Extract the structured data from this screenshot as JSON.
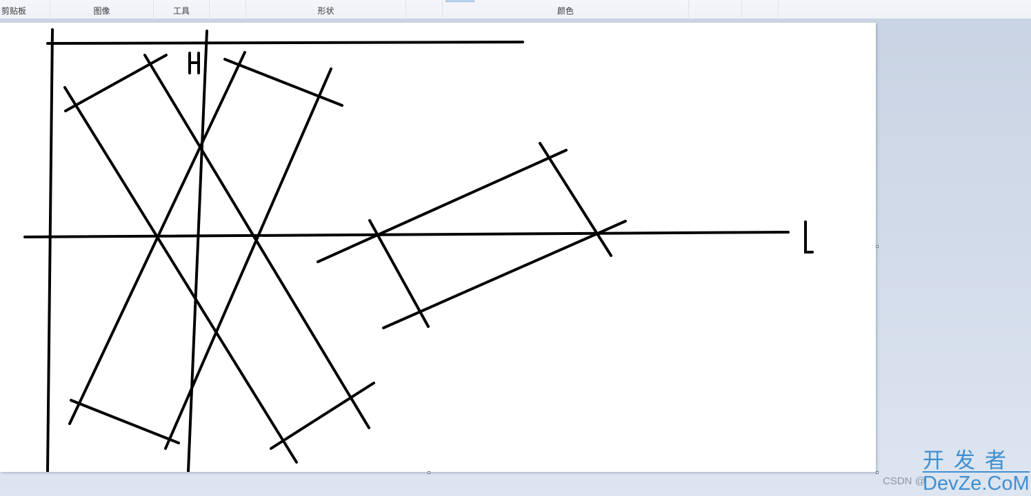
{
  "ribbon": {
    "groups": [
      {
        "label": "剪贴板"
      },
      {
        "label": "图像"
      },
      {
        "label": "工具"
      },
      {
        "label": ""
      },
      {
        "label": "形状"
      },
      {
        "label": ""
      },
      {
        "label": "颜色"
      },
      {
        "label": ""
      },
      {
        "label": ""
      }
    ]
  },
  "canvas": {
    "background": "#ffffff",
    "stroke_color": "#000000",
    "labels": {
      "h": "H",
      "l": "L"
    }
  },
  "watermark": {
    "csdn": "CSDN @",
    "cn": "开发者",
    "en": "DevZe.CoM",
    "color": "#3e8fd1"
  }
}
